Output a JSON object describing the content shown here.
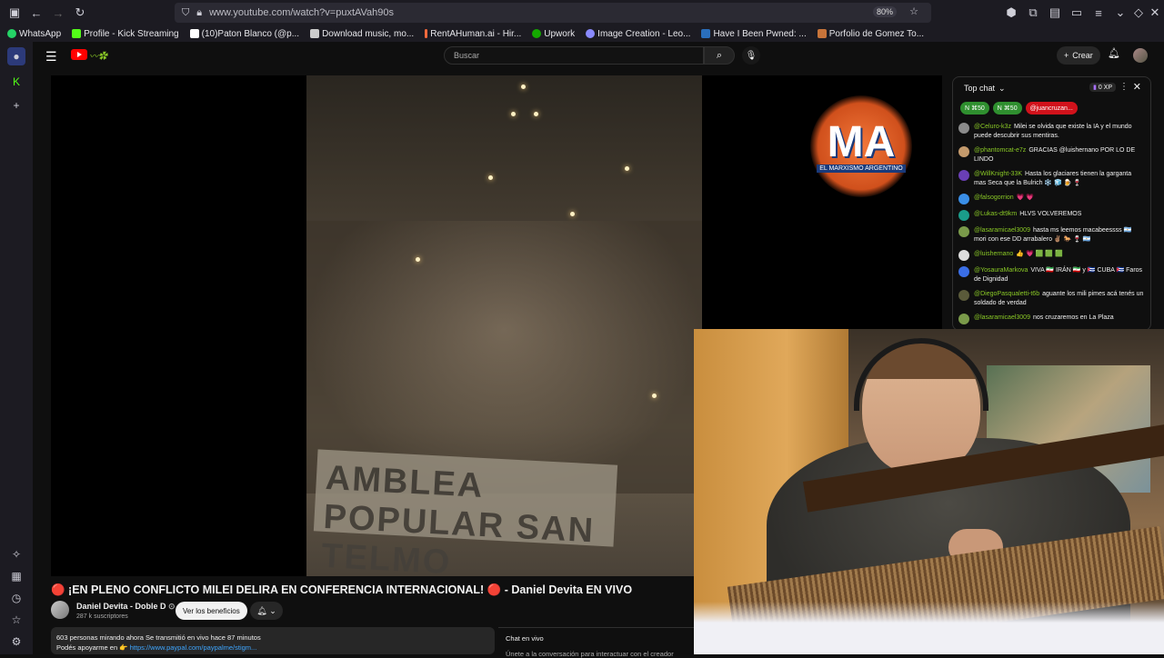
{
  "browser": {
    "url": "www.youtube.com/watch?v=puxtAVah90s",
    "zoom": "80%"
  },
  "bookmarks": [
    {
      "label": "WhatsApp",
      "color": "#25d366"
    },
    {
      "label": "Profile - Kick Streaming",
      "color": "#53fc18"
    },
    {
      "label": "(10)Paton Blanco (@p...",
      "color": "#ffffff"
    },
    {
      "label": "Download music, mo...",
      "color": "#cccccc"
    },
    {
      "label": "RentAHuman.ai - Hir...",
      "color": "#ff6a3d"
    },
    {
      "label": "Upwork",
      "color": "#14a800"
    },
    {
      "label": "Image Creation - Leo...",
      "color": "#8a8aff"
    },
    {
      "label": "Have I Been Pwned: ...",
      "color": "#2a6ebb"
    },
    {
      "label": "Porfolio de Gomez To...",
      "color": "#c8743a"
    }
  ],
  "youtube": {
    "search_placeholder": "Buscar",
    "create_label": "Crear"
  },
  "video": {
    "title": "🔴 ¡EN PLENO CONFLICTO MILEI DELIRA EN CONFERENCIA INTERNACIONAL! 🔴 - Daniel Devita EN VIVO",
    "channel": "Daniel Devita - Doble D",
    "subscribers": "287 k suscriptores",
    "benefits_label": "Ver los beneficios",
    "watching": "603 personas mirando ahora  Se transmitió en vivo hace 87 minutos",
    "support_prefix": "Podés apoyarme en 👉 ",
    "support_link": "https://www.paypal.com/paypalme/stigm...",
    "banner_text": "AMBLEA POPULAR SAN TELMO",
    "logo_main": "MA",
    "logo_sub": "EL MARXISMO ARGENTINO"
  },
  "chat": {
    "mode": "Top chat",
    "xp": "0 XP",
    "chips": [
      {
        "label": "N  ⌘50",
        "color": "#2f8f2f"
      },
      {
        "label": "N  ⌘50",
        "color": "#2f8f2f"
      },
      {
        "label": "@juancruzan...",
        "color": "#d1121b"
      }
    ],
    "messages": [
      {
        "author": "@Celuro-k3z",
        "text": "Milei se olvida que existe la IA y el mundo puede descubrir sus mentiras.",
        "color": "#8b8b8b"
      },
      {
        "author": "@phantomcat-e7z",
        "text": "GRACIAS @luishernano POR LO DE LINDO",
        "color": "#c49a6c"
      },
      {
        "author": "@WillKnight-33K",
        "text": "Hasta los glaciares tienen la garganta mas Seca que la Bulrich ❄️ 🧊 🍺 🍷",
        "color": "#6a3fb5"
      },
      {
        "author": "@falsogorrion",
        "text": "💗 💗",
        "color": "#3a8ee6"
      },
      {
        "author": "@Lukas-dt9km",
        "text": "HLVS VOLVEREMOS",
        "color": "#1a9c8a"
      },
      {
        "author": "@lasaramicael3009",
        "text": "hasta ms leemos macabeessss 🇦🇷 mori con ese DD arrabalero ✌🏽 🐎 🍷 🇦🇷",
        "color": "#7a9a4a"
      },
      {
        "author": "@luishernano",
        "text": "👍 💗 🟩 🟩 🟩",
        "color": "#dddddd"
      },
      {
        "author": "@YosauraMarkova",
        "text": "VIVA 🇮🇷 IRÁN 🇮🇷 y 🇨🇺 CUBA 🇨🇺 Faros de Dignidad",
        "color": "#3a6ee6"
      },
      {
        "author": "@DiegoPasqualetti-t6b",
        "text": "aguante los mili pimes acá tenés un soldado de verdad",
        "color": "#5a5a3a"
      },
      {
        "author": "@lasaramicael3009",
        "text": "nos cruzaremos en La Plaza",
        "color": "#7a9a4a"
      }
    ],
    "bottom_title": "Chat en vivo",
    "bottom_hint": "Únete a la conversación para interactuar con el creador"
  }
}
